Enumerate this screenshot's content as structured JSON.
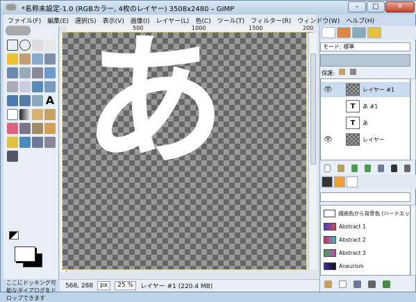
{
  "window": {
    "title": "*名称未設定-1.0 (RGBカラー, 4枚のレイヤー) 3508x2480 – GIMP",
    "minimize": "–",
    "maximize": "□",
    "close": "✕"
  },
  "menu": {
    "file": "ファイル(F)",
    "edit": "編集(E)",
    "select": "選択(S)",
    "view": "表示(V)",
    "image": "画像(I)",
    "layer": "レイヤー(L)",
    "colors": "色(C)",
    "tools": "ツール(T)",
    "filters": "フィルター(R)",
    "windows": "ウィンドウ(W)",
    "help": "ヘルプ(H)"
  },
  "toolbox": {
    "dock_note": "ここにドッキング可能なダイアログをドロップできます"
  },
  "ruler": {
    "ticks": [
      "500",
      "1000",
      "1500",
      "200"
    ]
  },
  "canvas": {
    "glyph": "あ"
  },
  "statusbar": {
    "coords": "568, 288",
    "unit": "px",
    "zoom": "25 %",
    "info": "レイヤー #1 (220.4 MB)"
  },
  "layers_panel": {
    "mode_label": "モード: 標準",
    "lock_label": "保護:",
    "layers": [
      {
        "name": "レイヤー #1",
        "visible": true,
        "selected": true,
        "kind": "checker"
      },
      {
        "name": "あ #1",
        "visible": false,
        "selected": false,
        "kind": "text"
      },
      {
        "name": "あ",
        "visible": false,
        "selected": false,
        "kind": "text"
      },
      {
        "name": "レイヤー",
        "visible": true,
        "selected": false,
        "kind": "checker"
      }
    ]
  },
  "gradients": {
    "items": [
      {
        "name": "描画色から背景色 (ハードエッ",
        "colors": [
          "#ffffff",
          "#ffffff"
        ]
      },
      {
        "name": "Abstract 1",
        "colors": [
          "#3a40d8",
          "#e04848"
        ]
      },
      {
        "name": "Abstract 2",
        "colors": [
          "#e8205c",
          "#30c0d0"
        ]
      },
      {
        "name": "Abstract 3",
        "colors": [
          "#30b050",
          "#d040c0"
        ]
      },
      {
        "name": "Aneurism",
        "colors": [
          "#4030a0",
          "#101010"
        ]
      }
    ]
  },
  "colors": {
    "accent": "#5c7aa0",
    "selection_outline": "#e8d31f",
    "checker_dark": "#666666",
    "checker_light": "#9a9a9a"
  }
}
